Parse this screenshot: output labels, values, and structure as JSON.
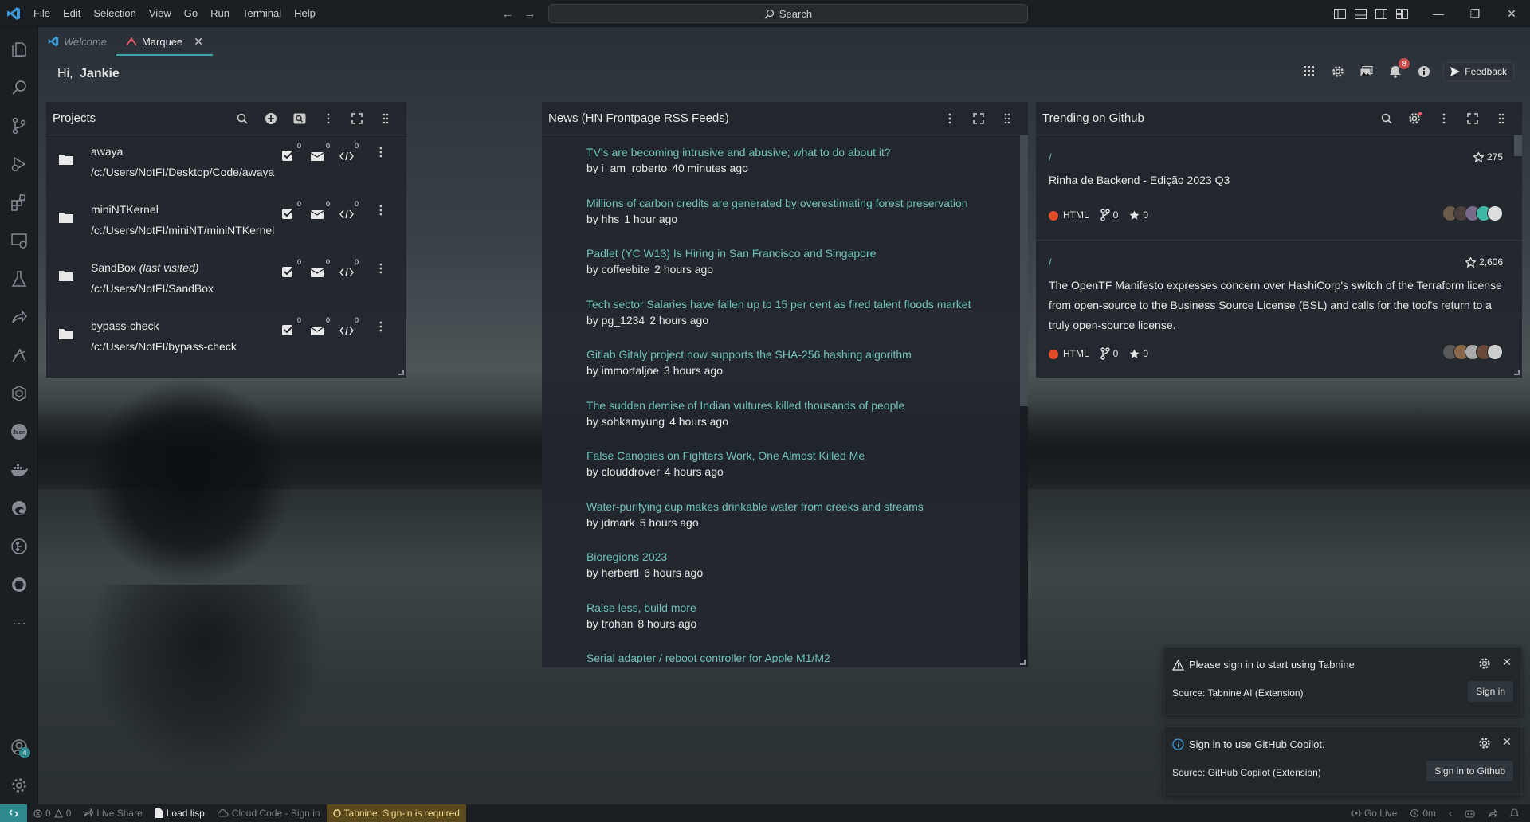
{
  "menu": [
    "File",
    "Edit",
    "Selection",
    "View",
    "Go",
    "Run",
    "Terminal",
    "Help"
  ],
  "search": {
    "label": "Search"
  },
  "tabs": [
    {
      "label": "Welcome"
    },
    {
      "label": "Marquee"
    }
  ],
  "header": {
    "greeting_prefix": "Hi,",
    "user_name": "Jankie",
    "notification_count": "8",
    "feedback_label": "Feedback"
  },
  "projects": {
    "title": "Projects",
    "items": [
      {
        "name": "awaya",
        "suffix": "",
        "path": "/c:/Users/NotFI/Desktop/Code/awaya",
        "todos": "0",
        "notes": "0",
        "snippets": "0"
      },
      {
        "name": "miniNTKernel",
        "suffix": "",
        "path": "/c:/Users/NotFI/miniNT/miniNTKernel",
        "todos": "0",
        "notes": "0",
        "snippets": "0"
      },
      {
        "name": "SandBox",
        "suffix": "(last visited)",
        "path": "/c:/Users/NotFI/SandBox",
        "todos": "0",
        "notes": "0",
        "snippets": "0"
      },
      {
        "name": "bypass-check",
        "suffix": "",
        "path": "/c:/Users/NotFI/bypass-check",
        "todos": "0",
        "notes": "0",
        "snippets": "0"
      }
    ]
  },
  "news": {
    "title": "News (HN Frontpage RSS Feeds)",
    "items": [
      {
        "title": "TV's are becoming intrusive and abusive; what to do about it?",
        "by": "by i_am_roberto",
        "time": "40 minutes ago"
      },
      {
        "title": "Millions of carbon credits are generated by overestimating forest preservation",
        "by": "by hhs",
        "time": "1 hour ago"
      },
      {
        "title": "Padlet (YC W13) Is Hiring in San Francisco and Singapore",
        "by": "by coffeebite",
        "time": "2 hours ago"
      },
      {
        "title": "Tech sector Salaries have fallen up to 15 per cent as fired talent floods market",
        "by": "by pg_1234",
        "time": "2 hours ago"
      },
      {
        "title": "Gitlab Gitaly project now supports the SHA-256 hashing algorithm",
        "by": "by immortaljoe",
        "time": "3 hours ago"
      },
      {
        "title": "The sudden demise of Indian vultures killed thousands of people",
        "by": "by sohkamyung",
        "time": "4 hours ago"
      },
      {
        "title": "False Canopies on Fighters Work, One Almost Killed Me",
        "by": "by clouddrover",
        "time": "4 hours ago"
      },
      {
        "title": "Water-purifying cup makes drinkable water from creeks and streams",
        "by": "by jdmark",
        "time": "5 hours ago"
      },
      {
        "title": "Bioregions 2023",
        "by": "by herbertl",
        "time": "6 hours ago"
      },
      {
        "title": "Raise less, build more",
        "by": "by trohan",
        "time": "8 hours ago"
      },
      {
        "title": "Serial adapter / reboot controller for Apple M1/M2",
        "by": "",
        "time": ""
      }
    ]
  },
  "trending": {
    "title": "Trending on Github",
    "repos": [
      {
        "slash": "/",
        "stars": "275",
        "description": "Rinha de Backend - Edição 2023 Q3",
        "language": "HTML",
        "forks": "0",
        "stargazers": "0"
      },
      {
        "slash": "/",
        "stars": "2,606",
        "description": "The OpenTF Manifesto expresses concern over HashiCorp's switch of the Terraform license from open-source to the Business Source License (BSL) and calls for the tool's return to a truly open-source license.",
        "language": "HTML",
        "forks": "0",
        "stargazers": "0"
      }
    ]
  },
  "notifications": [
    {
      "message": "Please sign in to start using Tabnine",
      "source": "Source: Tabnine AI (Extension)",
      "button": "Sign in",
      "icon": "warning-icon"
    },
    {
      "message": "Sign in to use GitHub Copilot.",
      "source": "Source: GitHub Copilot (Extension)",
      "button": "Sign in to Github",
      "icon": "info-icon"
    }
  ],
  "activity_bar": {
    "accounts_badge": "4",
    "icons": [
      "explorer-icon",
      "search-icon",
      "source-control-icon",
      "run-debug-icon",
      "extensions-icon",
      "remote-explorer-icon",
      "testing-icon",
      "live-share-icon",
      "deploy-icon",
      "kubernetes-icon",
      "json-icon",
      "docker-icon",
      "edge-icon",
      "gitlens-icon",
      "github-icon",
      "more-icon",
      "accounts-icon",
      "manage-gear-icon"
    ]
  },
  "statusbar": {
    "problems": "0",
    "warnings": "0",
    "live_share": "Live Share",
    "load_lisp": "Load lisp",
    "cloud_code": "Cloud Code - Sign in",
    "tabnine": "Tabnine: Sign-in is required",
    "go_live": "Go Live",
    "timer": "0m"
  },
  "colors": {
    "accent": "#3fa5a8",
    "link": "#6fc2ba",
    "html_lang": "#e34c26",
    "badge": "#c94a4a"
  }
}
